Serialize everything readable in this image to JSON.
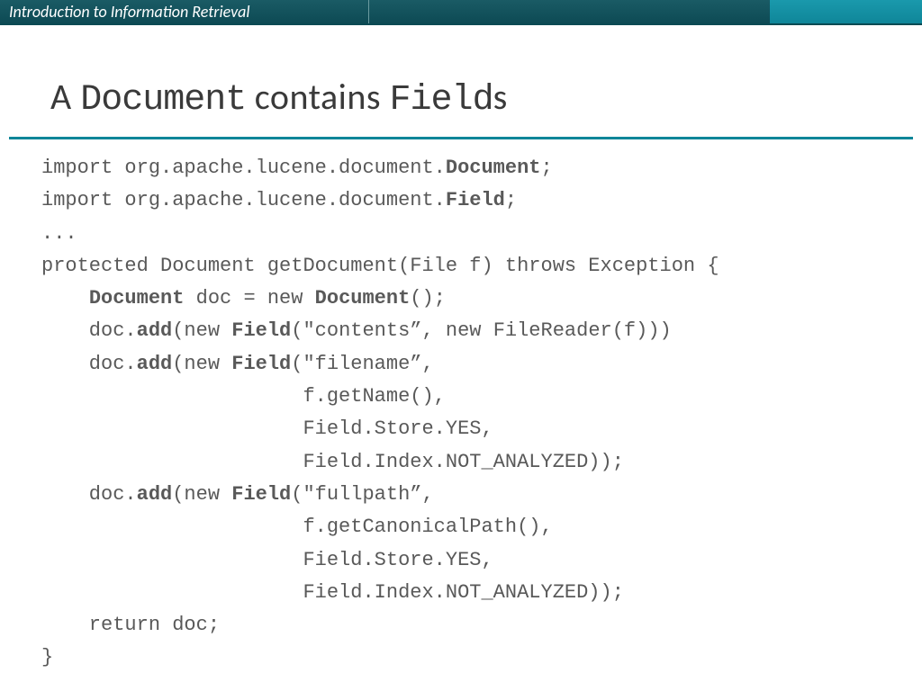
{
  "header": {
    "title": "Introduction to Information Retrieval"
  },
  "slide": {
    "title_prefix": "A ",
    "title_mono1": "Document",
    "title_mid": " contains ",
    "title_mono2": "Field",
    "title_suffix": "s"
  },
  "code": {
    "l01a": "import org.apache.lucene.document.",
    "l01b": "Document",
    "l01c": ";",
    "l02a": "import org.apache.lucene.document.",
    "l02b": "Field",
    "l02c": ";",
    "l03": "...",
    "l04": "protected Document getDocument(File f) throws Exception {",
    "l05a": "    ",
    "l05b": "Document",
    "l05c": " doc = new ",
    "l05d": "Document",
    "l05e": "();",
    "l06a": "    doc.",
    "l06b": "add",
    "l06c": "(new ",
    "l06d": "Field",
    "l06e": "(\"contents”, new FileReader(f)))",
    "l07a": "    doc.",
    "l07b": "add",
    "l07c": "(new ",
    "l07d": "Field",
    "l07e": "(\"filename”,",
    "l08": "                      f.getName(),",
    "l09": "                      Field.Store.YES,",
    "l10": "                      Field.Index.NOT_ANALYZED));",
    "l11a": "    doc.",
    "l11b": "add",
    "l11c": "(new ",
    "l11d": "Field",
    "l11e": "(\"fullpath”,",
    "l12": "                      f.getCanonicalPath(),",
    "l13": "                      Field.Store.YES,",
    "l14": "                      Field.Index.NOT_ANALYZED));",
    "l15": "    return doc;",
    "l16": "}"
  }
}
